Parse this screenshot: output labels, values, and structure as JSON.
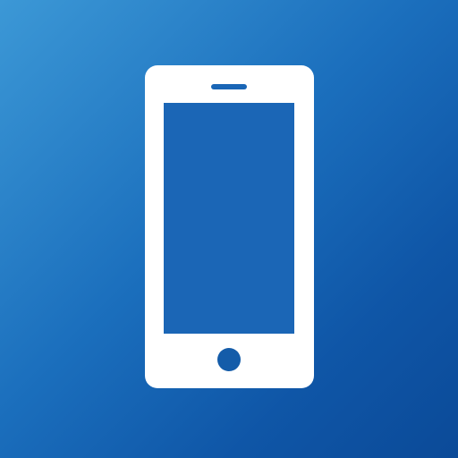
{
  "icon": {
    "name": "smartphone-icon",
    "background_gradient": [
      "#3c98d6",
      "#1b6fbd",
      "#0f56a7",
      "#0b4a98"
    ],
    "glyph_color": "#ffffff"
  }
}
